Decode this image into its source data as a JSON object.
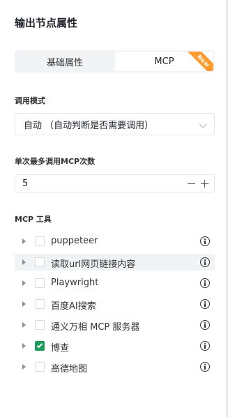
{
  "panel": {
    "title": "输出节点属性"
  },
  "tabs": [
    {
      "label": "基础属性",
      "active": false
    },
    {
      "label": "MCP",
      "active": true,
      "badge": "New"
    }
  ],
  "call_mode": {
    "label": "调用模式",
    "selected": "自动 （自动判断是否需要调用）"
  },
  "max_calls": {
    "label": "单次最多调用MCP次数",
    "value": "5"
  },
  "mcp_tools": {
    "label": "MCP 工具",
    "items": [
      {
        "name": "puppeteer",
        "checked": false
      },
      {
        "name": "读取url网页链接内容",
        "checked": false
      },
      {
        "name": "Playwright",
        "checked": false
      },
      {
        "name": "百度AI搜索",
        "checked": false
      },
      {
        "name": "通义万相 MCP 服务器",
        "checked": false
      },
      {
        "name": "博查",
        "checked": true
      },
      {
        "name": "高德地图",
        "checked": false
      }
    ]
  },
  "colors": {
    "accent_check": "#1e9a5a",
    "badge": "#ff9a2e"
  }
}
